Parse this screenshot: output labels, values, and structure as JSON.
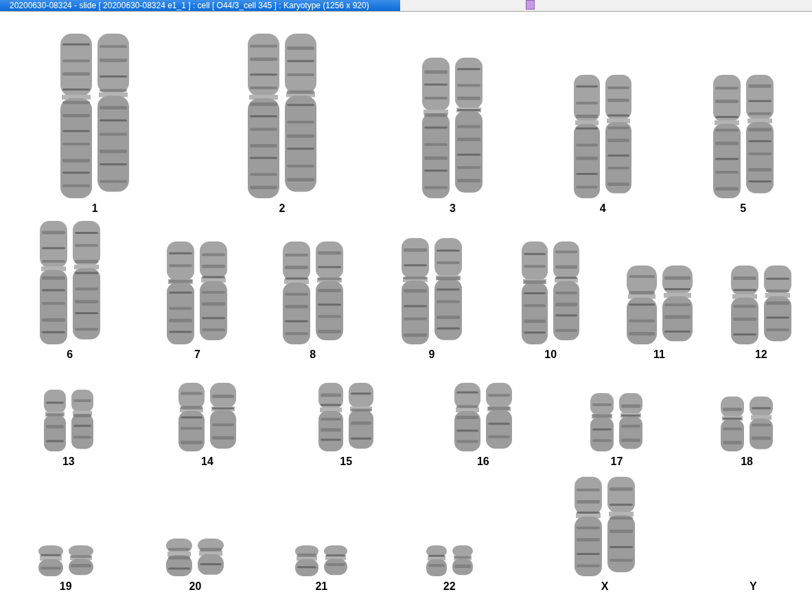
{
  "window": {
    "title": "20200630-08324 - slide [ 20200630-08324 e1_1 ] : cell [ O44/3_cell 345 ] : Karyotype  (1256 x 920)",
    "active": true
  },
  "karyotype": {
    "rows": [
      {
        "pairs": [
          {
            "label": "1",
            "present": true
          },
          {
            "label": "2",
            "present": true
          },
          {
            "label": "3",
            "present": true
          },
          {
            "label": "4",
            "present": true
          },
          {
            "label": "5",
            "present": true
          }
        ]
      },
      {
        "pairs": [
          {
            "label": "6",
            "present": true
          },
          {
            "label": "7",
            "present": true
          },
          {
            "label": "8",
            "present": true
          },
          {
            "label": "9",
            "present": true
          },
          {
            "label": "10",
            "present": true
          },
          {
            "label": "11",
            "present": true
          },
          {
            "label": "12",
            "present": true
          }
        ]
      },
      {
        "pairs": [
          {
            "label": "13",
            "present": true
          },
          {
            "label": "14",
            "present": true
          },
          {
            "label": "15",
            "present": true
          },
          {
            "label": "16",
            "present": true
          },
          {
            "label": "17",
            "present": true
          },
          {
            "label": "18",
            "present": true
          }
        ]
      },
      {
        "pairs": [
          {
            "label": "19",
            "present": true
          },
          {
            "label": "20",
            "present": true
          },
          {
            "label": "21",
            "present": true
          },
          {
            "label": "22",
            "present": true
          },
          {
            "label": "X",
            "present": true
          },
          {
            "label": "Y",
            "present": false
          }
        ]
      }
    ]
  }
}
